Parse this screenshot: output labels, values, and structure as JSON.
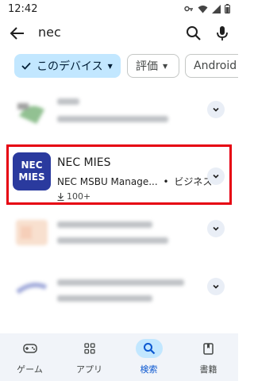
{
  "status_bar": {
    "time": "12:42"
  },
  "search": {
    "query": "nec"
  },
  "chips": [
    {
      "label": "このデバイス",
      "selected": true
    },
    {
      "label": "評価"
    },
    {
      "label": "Android A"
    }
  ],
  "results": {
    "highlighted": {
      "icon_text_top": "NEC",
      "icon_text_bottom": "MIES",
      "title": "NEC MIES",
      "developer": "NEC MSBU Manage...",
      "separator": "•",
      "category": "ビジネス",
      "downloads": "100+"
    }
  },
  "bottom_nav": [
    {
      "label": "ゲーム",
      "icon": "gamepad-icon"
    },
    {
      "label": "アプリ",
      "icon": "apps-grid-icon"
    },
    {
      "label": "検索",
      "icon": "search-icon",
      "active": true
    },
    {
      "label": "書籍",
      "icon": "book-icon"
    }
  ],
  "colors": {
    "highlight": "#e60012",
    "app_icon": "#2a3a9e",
    "chip_selected": "#c2e7ff"
  }
}
